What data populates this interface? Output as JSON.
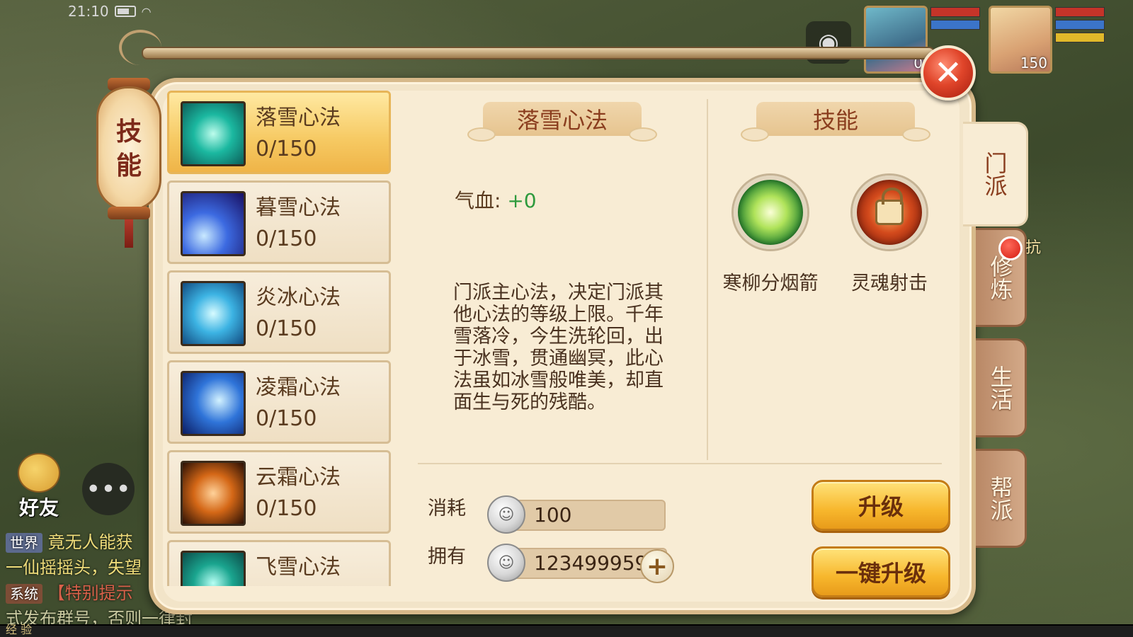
{
  "status_bar": {
    "time": "21:10"
  },
  "portraits": [
    {
      "level": "0"
    },
    {
      "level": "150"
    }
  ],
  "panel_title": [
    "技",
    "能"
  ],
  "skill_list": [
    {
      "name": "落雪心法",
      "level": "0/150",
      "selected": true
    },
    {
      "name": "暮雪心法",
      "level": "0/150",
      "selected": false
    },
    {
      "name": "炎冰心法",
      "level": "0/150",
      "selected": false
    },
    {
      "name": "凌霜心法",
      "level": "0/150",
      "selected": false
    },
    {
      "name": "云霜心法",
      "level": "0/150",
      "selected": false
    },
    {
      "name": "飞雪心法",
      "level": "",
      "selected": false
    }
  ],
  "detail": {
    "title": "落雪心法",
    "stat_label": "气血:",
    "stat_value": "+0",
    "description": "门派主心法，决定门派其他心法的等级上限。千年雪落冷，今生洗轮回，出于冰雪，贯通幽冥，此心法虽如冰雪般唯美，却直面生与死的残酷。"
  },
  "skills_panel": {
    "title": "技能",
    "skills": [
      {
        "name": "寒柳分烟箭",
        "locked": false
      },
      {
        "name": "灵魂射击",
        "locked": true
      }
    ]
  },
  "cost": {
    "consume_label": "消耗",
    "consume_value": "100",
    "own_label": "拥有",
    "own_value": "123499959"
  },
  "buttons": {
    "upgrade": "升级",
    "upgrade_all": "一键升级",
    "close": "✕"
  },
  "side_tabs": [
    {
      "label": "门派",
      "active": true
    },
    {
      "label": "修炼",
      "active": false
    },
    {
      "label": "生活",
      "active": false
    },
    {
      "label": "帮派",
      "active": false
    }
  ],
  "resist_text": "抗",
  "chat": {
    "friend_label": "好友",
    "lines": [
      {
        "tag": "世界",
        "text": "竟无人能获"
      },
      {
        "tag": "",
        "text": "一仙摇摇头，失望"
      },
      {
        "tag": "系统",
        "text": "【特别提示"
      },
      {
        "tag": "",
        "text": "式发布群号，否则一律封号处理"
      }
    ],
    "xp_label": "经 验"
  },
  "colors": {
    "accent_gold": "#f7b72d",
    "title_red": "#8a3d1e",
    "stat_green": "#2e9a3d",
    "close_red": "#e0452a"
  }
}
